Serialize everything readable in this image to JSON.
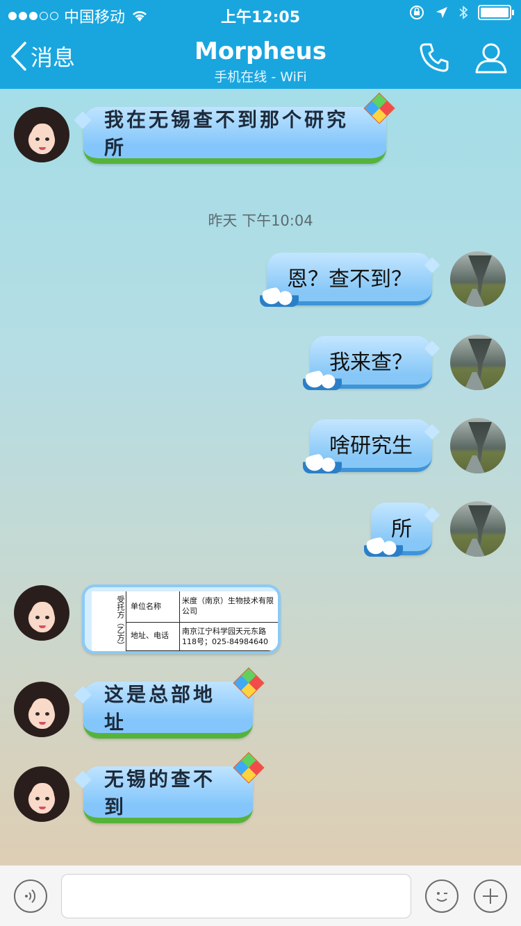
{
  "status_bar": {
    "carrier": "中国移动",
    "time": "上午12:05",
    "signal_icon": "signal-dots-icon",
    "wifi_icon": "wifi-icon",
    "right_icons": [
      "rotation-lock-icon",
      "location-arrow-icon",
      "bluetooth-icon",
      "battery-icon"
    ]
  },
  "nav": {
    "back_label": "消息",
    "title": "Morpheus",
    "subtitle": "手机在线 - WiFi",
    "call_icon": "phone-icon",
    "profile_icon": "person-icon"
  },
  "messages": [
    {
      "side": "left",
      "text": "我在无锡查不到那个研究所"
    },
    {
      "side": "center",
      "text": "昨天 下午10:04"
    },
    {
      "side": "right",
      "text": "恩？查不到？"
    },
    {
      "side": "right",
      "text": "我来查？"
    },
    {
      "side": "right",
      "text": "啥研究生"
    },
    {
      "side": "right",
      "text": "所"
    },
    {
      "side": "left",
      "type": "image",
      "doc": {
        "party": "受托方（乙方）",
        "name_label": "单位名称",
        "name_value": "米度（南京）生物技术有限公司",
        "addr_label": "地址、电话",
        "addr_value": "南京江宁科学园天元东路118号；025-84984640"
      }
    },
    {
      "side": "left",
      "text": "这是总部地址"
    },
    {
      "side": "left",
      "text": "无锡的查不到"
    }
  ],
  "input_bar": {
    "voice_icon": "voice-icon",
    "emoji_icon": "emoji-icon",
    "plus_icon": "plus-icon",
    "placeholder": ""
  },
  "colors": {
    "nav_bg": "#19a6df",
    "bubble_left": "#84c6fb",
    "bubble_right": "#86c7f7",
    "grass": "#55b33a"
  }
}
